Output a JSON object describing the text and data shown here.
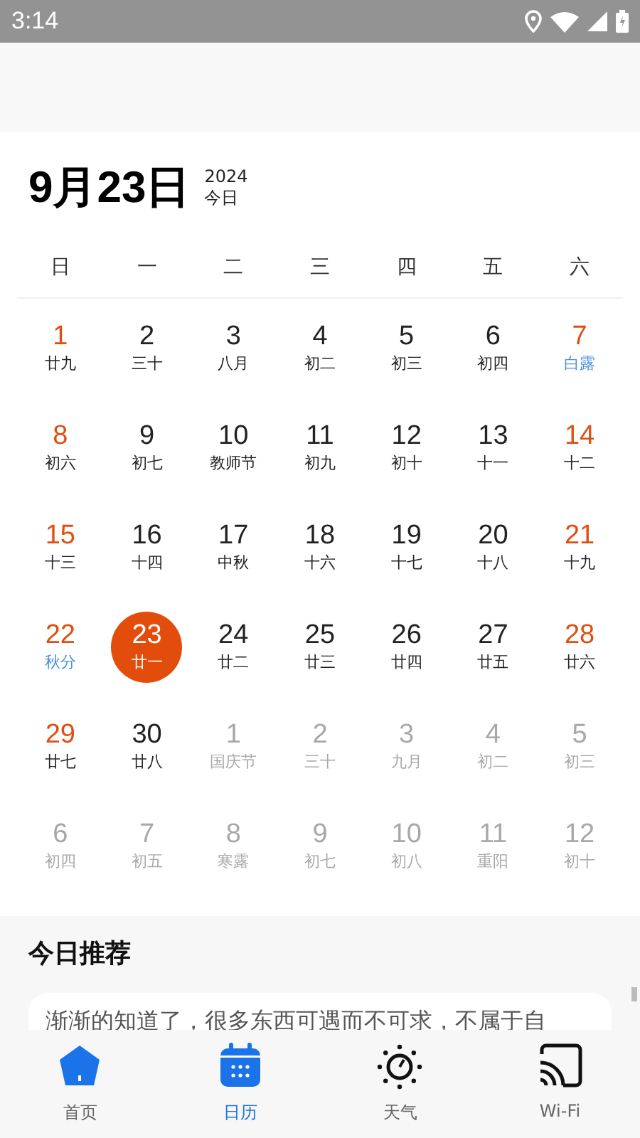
{
  "status_bar": {
    "time": "3:14"
  },
  "header": {
    "date": "9月23日",
    "year": "2024",
    "today_label": "今日"
  },
  "weekdays": [
    "日",
    "一",
    "二",
    "三",
    "四",
    "五",
    "六"
  ],
  "days": [
    {
      "day": "1",
      "lunar": "廿九",
      "weekend": true,
      "solar_term": false,
      "other_month": false,
      "selected": false
    },
    {
      "day": "2",
      "lunar": "三十",
      "weekend": false,
      "solar_term": false,
      "other_month": false,
      "selected": false
    },
    {
      "day": "3",
      "lunar": "八月",
      "weekend": false,
      "solar_term": false,
      "other_month": false,
      "selected": false
    },
    {
      "day": "4",
      "lunar": "初二",
      "weekend": false,
      "solar_term": false,
      "other_month": false,
      "selected": false
    },
    {
      "day": "5",
      "lunar": "初三",
      "weekend": false,
      "solar_term": false,
      "other_month": false,
      "selected": false
    },
    {
      "day": "6",
      "lunar": "初四",
      "weekend": false,
      "solar_term": false,
      "other_month": false,
      "selected": false
    },
    {
      "day": "7",
      "lunar": "白露",
      "weekend": true,
      "solar_term": true,
      "other_month": false,
      "selected": false
    },
    {
      "day": "8",
      "lunar": "初六",
      "weekend": true,
      "solar_term": false,
      "other_month": false,
      "selected": false
    },
    {
      "day": "9",
      "lunar": "初七",
      "weekend": false,
      "solar_term": false,
      "other_month": false,
      "selected": false
    },
    {
      "day": "10",
      "lunar": "教师节",
      "weekend": false,
      "solar_term": false,
      "other_month": false,
      "selected": false
    },
    {
      "day": "11",
      "lunar": "初九",
      "weekend": false,
      "solar_term": false,
      "other_month": false,
      "selected": false
    },
    {
      "day": "12",
      "lunar": "初十",
      "weekend": false,
      "solar_term": false,
      "other_month": false,
      "selected": false
    },
    {
      "day": "13",
      "lunar": "十一",
      "weekend": false,
      "solar_term": false,
      "other_month": false,
      "selected": false
    },
    {
      "day": "14",
      "lunar": "十二",
      "weekend": true,
      "solar_term": false,
      "other_month": false,
      "selected": false
    },
    {
      "day": "15",
      "lunar": "十三",
      "weekend": true,
      "solar_term": false,
      "other_month": false,
      "selected": false
    },
    {
      "day": "16",
      "lunar": "十四",
      "weekend": false,
      "solar_term": false,
      "other_month": false,
      "selected": false
    },
    {
      "day": "17",
      "lunar": "中秋",
      "weekend": false,
      "solar_term": false,
      "other_month": false,
      "selected": false
    },
    {
      "day": "18",
      "lunar": "十六",
      "weekend": false,
      "solar_term": false,
      "other_month": false,
      "selected": false
    },
    {
      "day": "19",
      "lunar": "十七",
      "weekend": false,
      "solar_term": false,
      "other_month": false,
      "selected": false
    },
    {
      "day": "20",
      "lunar": "十八",
      "weekend": false,
      "solar_term": false,
      "other_month": false,
      "selected": false
    },
    {
      "day": "21",
      "lunar": "十九",
      "weekend": true,
      "solar_term": false,
      "other_month": false,
      "selected": false
    },
    {
      "day": "22",
      "lunar": "秋分",
      "weekend": true,
      "solar_term": true,
      "other_month": false,
      "selected": false
    },
    {
      "day": "23",
      "lunar": "廿一",
      "weekend": false,
      "solar_term": false,
      "other_month": false,
      "selected": true
    },
    {
      "day": "24",
      "lunar": "廿二",
      "weekend": false,
      "solar_term": false,
      "other_month": false,
      "selected": false
    },
    {
      "day": "25",
      "lunar": "廿三",
      "weekend": false,
      "solar_term": false,
      "other_month": false,
      "selected": false
    },
    {
      "day": "26",
      "lunar": "廿四",
      "weekend": false,
      "solar_term": false,
      "other_month": false,
      "selected": false
    },
    {
      "day": "27",
      "lunar": "廿五",
      "weekend": false,
      "solar_term": false,
      "other_month": false,
      "selected": false
    },
    {
      "day": "28",
      "lunar": "廿六",
      "weekend": true,
      "solar_term": false,
      "other_month": false,
      "selected": false
    },
    {
      "day": "29",
      "lunar": "廿七",
      "weekend": true,
      "solar_term": false,
      "other_month": false,
      "selected": false
    },
    {
      "day": "30",
      "lunar": "廿八",
      "weekend": false,
      "solar_term": false,
      "other_month": false,
      "selected": false
    },
    {
      "day": "1",
      "lunar": "国庆节",
      "weekend": false,
      "solar_term": false,
      "other_month": true,
      "selected": false
    },
    {
      "day": "2",
      "lunar": "三十",
      "weekend": false,
      "solar_term": false,
      "other_month": true,
      "selected": false
    },
    {
      "day": "3",
      "lunar": "九月",
      "weekend": false,
      "solar_term": false,
      "other_month": true,
      "selected": false
    },
    {
      "day": "4",
      "lunar": "初二",
      "weekend": false,
      "solar_term": false,
      "other_month": true,
      "selected": false
    },
    {
      "day": "5",
      "lunar": "初三",
      "weekend": false,
      "solar_term": false,
      "other_month": true,
      "selected": false
    },
    {
      "day": "6",
      "lunar": "初四",
      "weekend": false,
      "solar_term": false,
      "other_month": true,
      "selected": false
    },
    {
      "day": "7",
      "lunar": "初五",
      "weekend": false,
      "solar_term": false,
      "other_month": true,
      "selected": false
    },
    {
      "day": "8",
      "lunar": "寒露",
      "weekend": false,
      "solar_term": false,
      "other_month": true,
      "selected": false
    },
    {
      "day": "9",
      "lunar": "初七",
      "weekend": false,
      "solar_term": false,
      "other_month": true,
      "selected": false
    },
    {
      "day": "10",
      "lunar": "初八",
      "weekend": false,
      "solar_term": false,
      "other_month": true,
      "selected": false
    },
    {
      "day": "11",
      "lunar": "重阳",
      "weekend": false,
      "solar_term": false,
      "other_month": true,
      "selected": false
    },
    {
      "day": "12",
      "lunar": "初十",
      "weekend": false,
      "solar_term": false,
      "other_month": true,
      "selected": false
    }
  ],
  "recommendation": {
    "title": "今日推荐",
    "text": "渐渐的知道了，很多东西可遇而不可求，不属于自"
  },
  "nav": [
    {
      "kind": "home",
      "label": "首页",
      "selected": false
    },
    {
      "kind": "calendar",
      "label": "日历",
      "selected": true
    },
    {
      "kind": "weather",
      "label": "天气",
      "selected": false
    },
    {
      "kind": "cast",
      "label": "Wi-Fi",
      "selected": false
    }
  ]
}
